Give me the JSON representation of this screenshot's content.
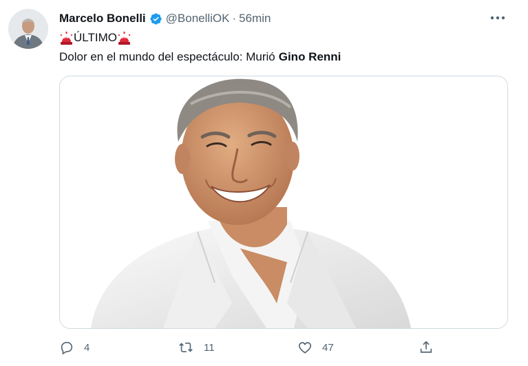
{
  "author": {
    "name": "Marcelo Bonelli",
    "handle": "@BonelliOK",
    "separator": "·",
    "time": "56min"
  },
  "tweet": {
    "headline": "ÚLTIMO",
    "text_prefix": "Dolor en el mundo del espectáculo: Murió",
    "text_bold": "Gino Renni"
  },
  "icons": {
    "verified": "verified-badge-icon",
    "siren": "police-siren-emoji",
    "more": "more-horizontal-icon",
    "reply": "reply-icon",
    "retweet": "retweet-icon",
    "like": "heart-icon",
    "share": "share-icon"
  },
  "actions": {
    "reply_count": "4",
    "retweet_count": "11",
    "like_count": "47"
  },
  "colors": {
    "text": "#0f1419",
    "secondary": "#536471",
    "verified": "#1d9bf0",
    "siren": "#e0293a",
    "border": "#cfd9de"
  }
}
